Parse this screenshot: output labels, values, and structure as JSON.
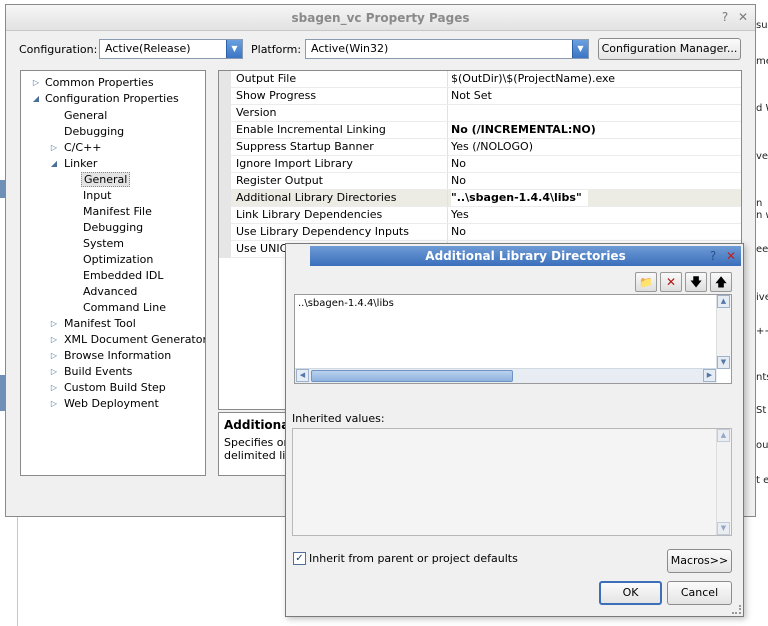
{
  "window": {
    "title": "sbagen_vc Property Pages",
    "help_glyph": "?",
    "close_glyph": "✕"
  },
  "toolbar": {
    "configuration_label": "Configuration:",
    "configuration_value": "Active(Release)",
    "platform_label": "Platform:",
    "platform_value": "Active(Win32)",
    "config_manager_label": "Configuration Manager..."
  },
  "tree": [
    {
      "label": "Common Properties",
      "arrow": "▷"
    },
    {
      "label": "Configuration Properties",
      "arrow": "◢"
    },
    {
      "label": "General",
      "arrow": ""
    },
    {
      "label": "Debugging",
      "arrow": ""
    },
    {
      "label": "C/C++",
      "arrow": "▷"
    },
    {
      "label": "Linker",
      "arrow": "◢"
    },
    {
      "label": "General",
      "arrow": "",
      "selected": true
    },
    {
      "label": "Input",
      "arrow": ""
    },
    {
      "label": "Manifest File",
      "arrow": ""
    },
    {
      "label": "Debugging",
      "arrow": ""
    },
    {
      "label": "System",
      "arrow": ""
    },
    {
      "label": "Optimization",
      "arrow": ""
    },
    {
      "label": "Embedded IDL",
      "arrow": ""
    },
    {
      "label": "Advanced",
      "arrow": ""
    },
    {
      "label": "Command Line",
      "arrow": ""
    },
    {
      "label": "Manifest Tool",
      "arrow": "▷"
    },
    {
      "label": "XML Document Generator",
      "arrow": "▷"
    },
    {
      "label": "Browse Information",
      "arrow": "▷"
    },
    {
      "label": "Build Events",
      "arrow": "▷"
    },
    {
      "label": "Custom Build Step",
      "arrow": "▷"
    },
    {
      "label": "Web Deployment",
      "arrow": "▷"
    }
  ],
  "properties": [
    {
      "name": "Output File",
      "value": "$(OutDir)\\$(ProjectName).exe"
    },
    {
      "name": "Show Progress",
      "value": "Not Set"
    },
    {
      "name": "Version",
      "value": ""
    },
    {
      "name": "Enable Incremental Linking",
      "value": "No (/INCREMENTAL:NO)",
      "bold": true
    },
    {
      "name": "Suppress Startup Banner",
      "value": "Yes (/NOLOGO)"
    },
    {
      "name": "Ignore Import Library",
      "value": "No"
    },
    {
      "name": "Register Output",
      "value": "No"
    },
    {
      "name": "Additional Library Directories",
      "value": "\"..\\sbagen-1.4.4\\libs\"",
      "bold": true,
      "selected": true
    },
    {
      "name": "Link Library Dependencies",
      "value": "Yes"
    },
    {
      "name": "Use Library Dependency Inputs",
      "value": "No"
    },
    {
      "name": "Use UNICO",
      "value": ""
    }
  ],
  "description": {
    "title": "Additional l",
    "line1": "Specifies one",
    "line2": "delimited list i"
  },
  "dialog": {
    "title": "Additional Library Directories",
    "help_glyph": "?",
    "close_glyph": "✕",
    "directory": "..\\sbagen-1.4.4\\libs",
    "inherited_label": "Inherited values:",
    "inherit_checkbox_label": "Inherit from parent or project defaults",
    "inherit_checked": "✓",
    "macros_label": "Macros>>",
    "ok_label": "OK",
    "cancel_label": "Cancel",
    "tools": {
      "new_folder_glyph": "📁",
      "delete_glyph": "✕",
      "move_down_glyph": "🡇",
      "move_up_glyph": "🡅"
    }
  },
  "background_fragments": {
    "f1": "sua",
    "f2": "me",
    "f3": "d W",
    "f4": "ver",
    "f5": "n",
    "f6": "n w",
    "f7": "ee",
    "f8": "ive",
    "f9": "++",
    "f10": "nts",
    "f11": "St",
    "f12": "ou",
    "f13": "t er"
  }
}
